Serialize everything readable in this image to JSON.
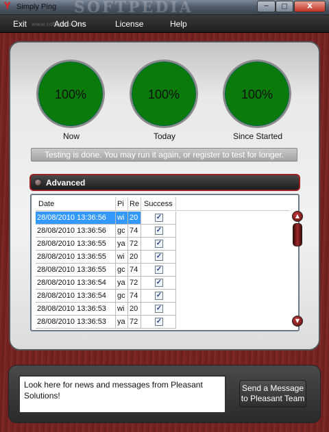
{
  "window": {
    "title": "Simply Ping",
    "watermark": "SOFTPEDIA",
    "watermark_url": "www.softpedia.com",
    "buttons": {
      "minimize": "─",
      "maximize": "□",
      "close": "X"
    }
  },
  "menu": {
    "items": [
      "Exit",
      "Add Ons",
      "License",
      "Help"
    ]
  },
  "gauges": [
    {
      "value": "100%",
      "label": "Now",
      "color": "#0a7a0a"
    },
    {
      "value": "100%",
      "label": "Today",
      "color": "#0a7a0a"
    },
    {
      "value": "100%",
      "label": "Since Started",
      "color": "#0a7a0a"
    }
  ],
  "status_message": "Testing is done. You may run it again, or register to test for longer.",
  "advanced": {
    "label": "Advanced"
  },
  "table": {
    "columns": [
      "Date",
      "Pi",
      "Re",
      "Success"
    ],
    "rows": [
      {
        "date": "28/08/2010 13:36:56",
        "ping": "wi",
        "re": "20",
        "success": true,
        "selected": true
      },
      {
        "date": "28/08/2010 13:36:56",
        "ping": "gc",
        "re": "74",
        "success": true,
        "selected": false
      },
      {
        "date": "28/08/2010 13:36:55",
        "ping": "ya",
        "re": "72",
        "success": true,
        "selected": false
      },
      {
        "date": "28/08/2010 13:36:55",
        "ping": "wi",
        "re": "20",
        "success": true,
        "selected": false
      },
      {
        "date": "28/08/2010 13:36:55",
        "ping": "gc",
        "re": "74",
        "success": true,
        "selected": false
      },
      {
        "date": "28/08/2010 13:36:54",
        "ping": "ya",
        "re": "72",
        "success": true,
        "selected": false
      },
      {
        "date": "28/08/2010 13:36:54",
        "ping": "gc",
        "re": "74",
        "success": true,
        "selected": false
      },
      {
        "date": "28/08/2010 13:36:53",
        "ping": "wi",
        "re": "20",
        "success": true,
        "selected": false
      },
      {
        "date": "28/08/2010 13:36:53",
        "ping": "ya",
        "re": "72",
        "success": true,
        "selected": false
      }
    ]
  },
  "news": "Look here for news and messages from Pleasant Solutions!",
  "send_button": "Send a Message to Pleasant Team",
  "colors": {
    "accent": "#9a2020",
    "selection": "#3399ff",
    "gauge": "#0a7a0a"
  }
}
